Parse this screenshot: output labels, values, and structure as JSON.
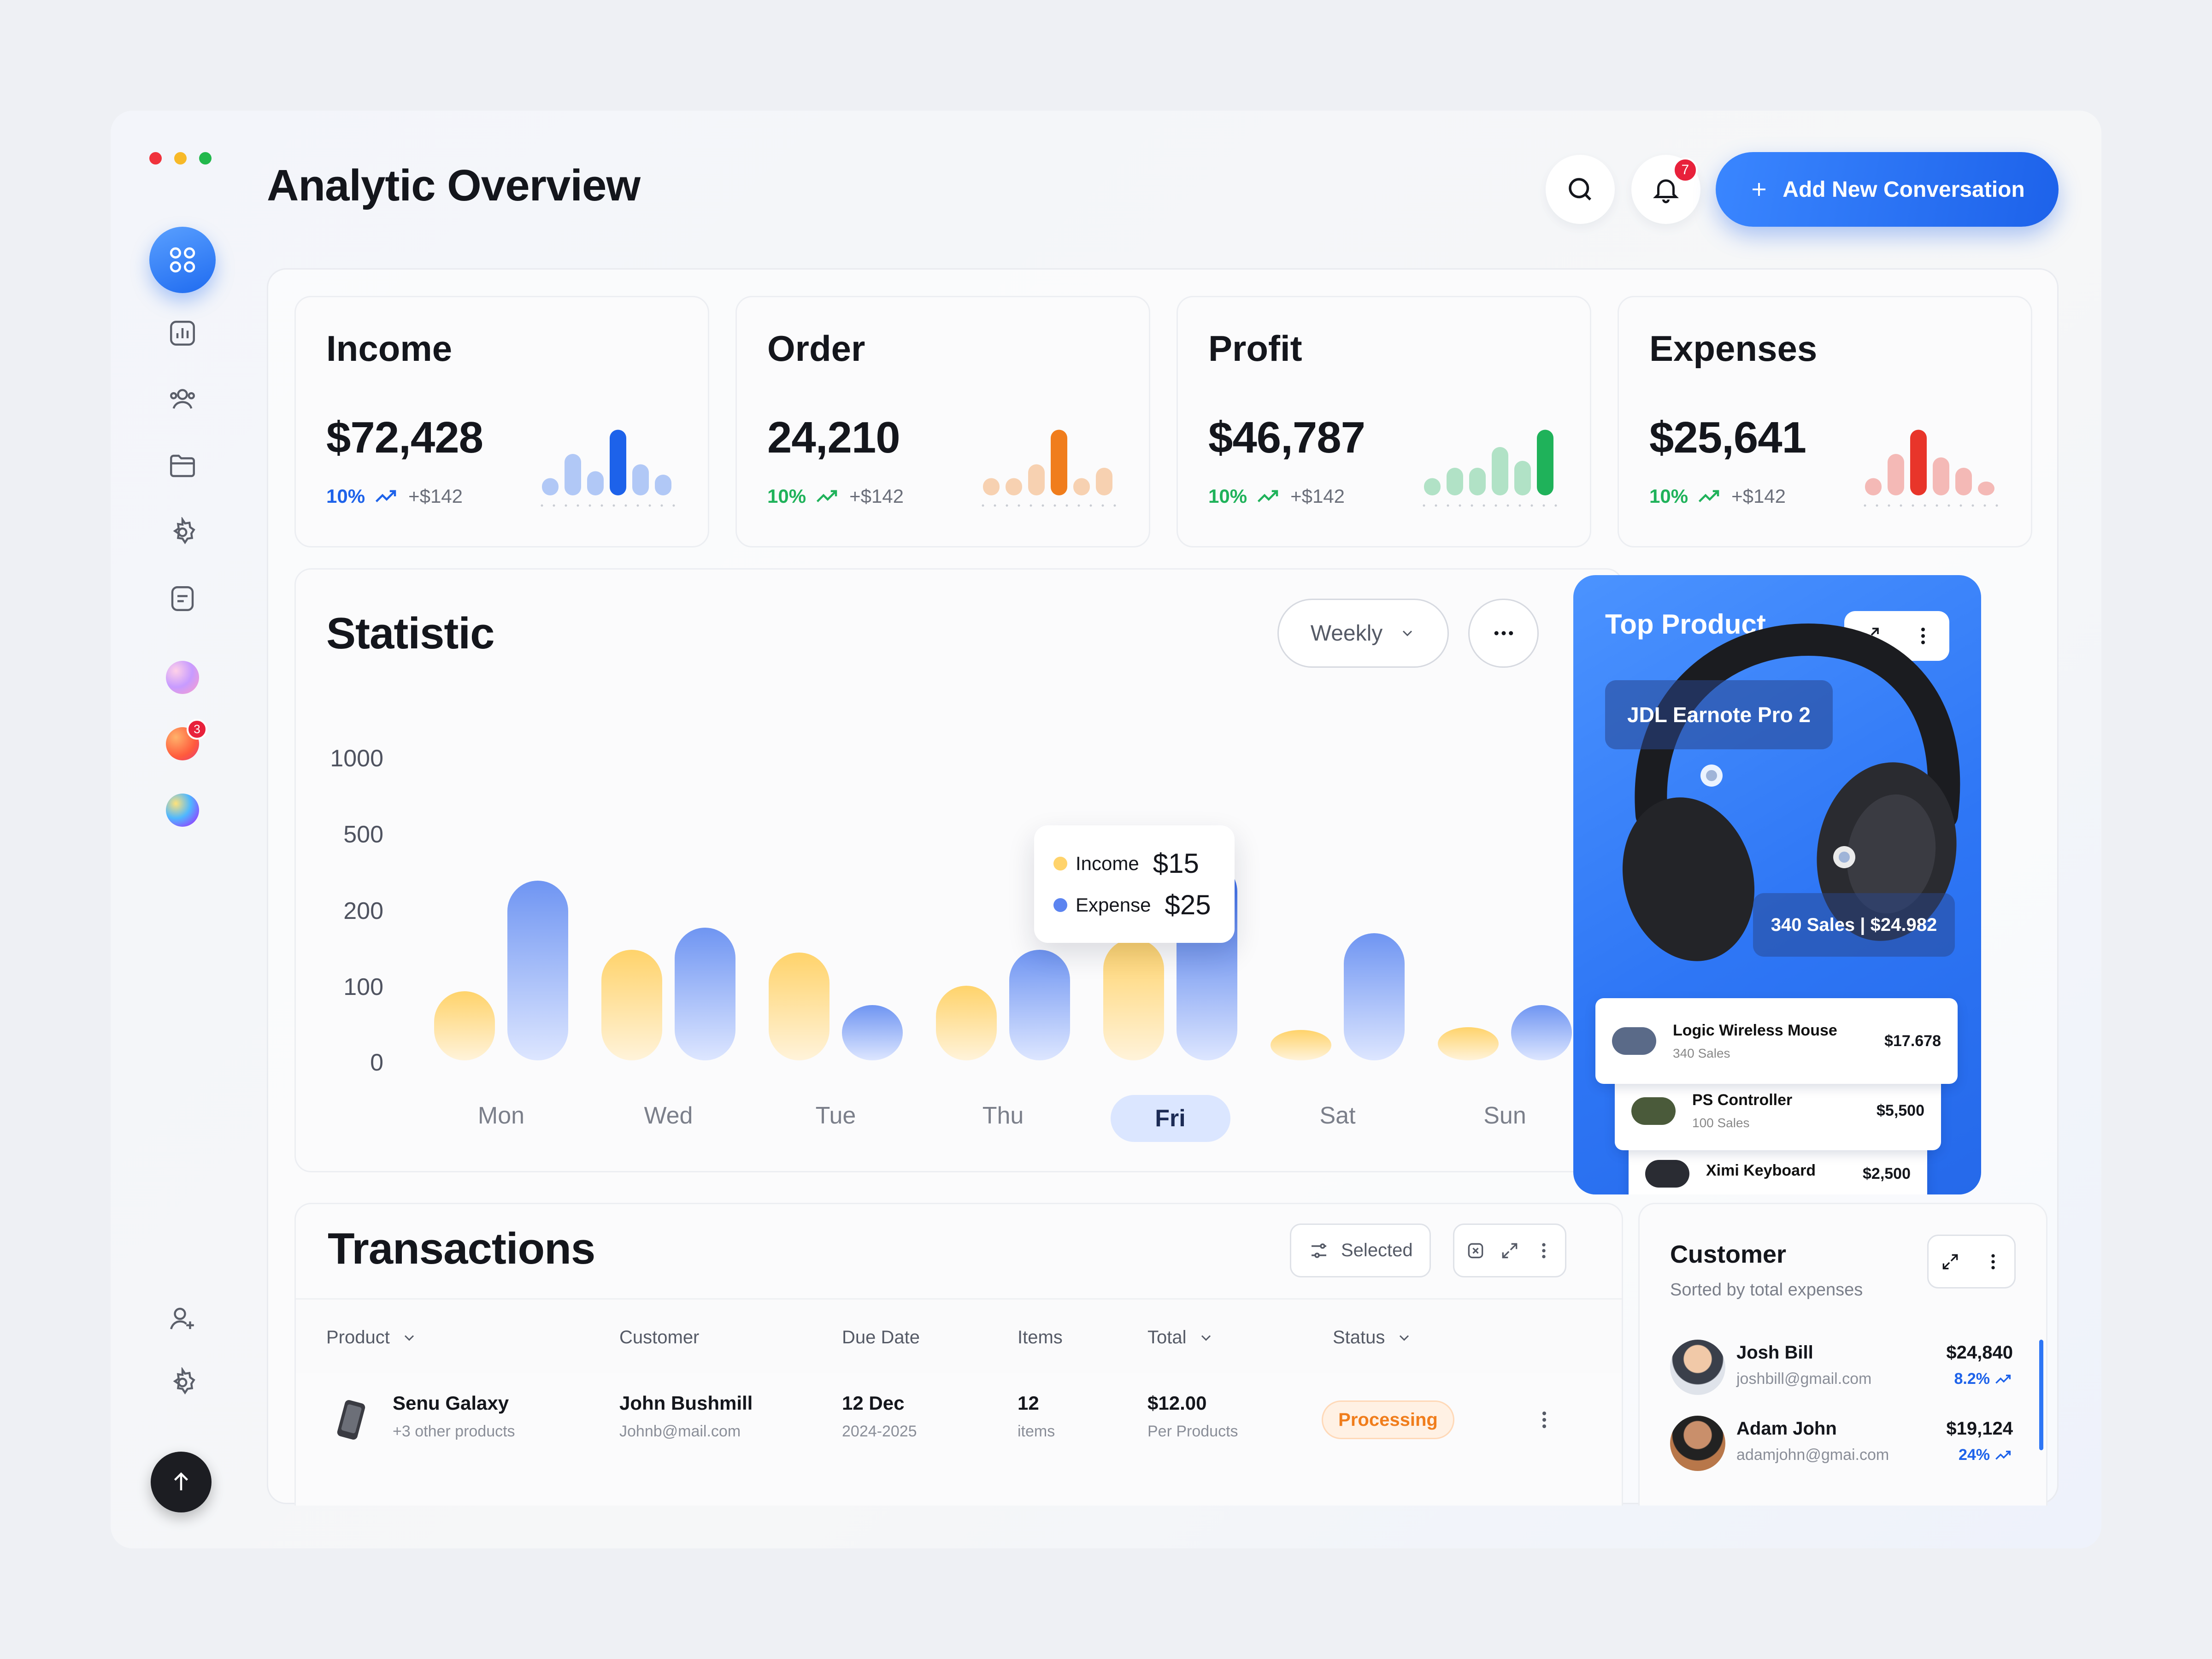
{
  "header": {
    "title": "Analytic Overview",
    "notification_count": "7",
    "cta_label": "Add New Conversation"
  },
  "sidebar": {
    "nav_icons": [
      "dashboard-icon",
      "bar-chart-icon",
      "users-icon",
      "folder-icon",
      "settings-icon",
      "document-icon"
    ],
    "workspace_badge": "3",
    "bottom_icons": [
      "add-user-icon",
      "settings-icon",
      "arrow-up-icon"
    ]
  },
  "kpis": [
    {
      "title": "Income",
      "value": "$72,428",
      "pct": "10%",
      "delta": "+$142",
      "color": "#1d62ea",
      "bars": [
        0.25,
        0.6,
        0.35,
        0.95,
        0.45,
        0.3
      ]
    },
    {
      "title": "Order",
      "value": "24,210",
      "pct": "10%",
      "delta": "+$142",
      "color": "#f07d1c",
      "bars": [
        0.25,
        0.25,
        0.45,
        0.95,
        0.25,
        0.4
      ]
    },
    {
      "title": "Profit",
      "value": "$46,787",
      "pct": "10%",
      "delta": "+$142",
      "color": "#1fb25a",
      "bars": [
        0.25,
        0.4,
        0.4,
        0.7,
        0.5,
        0.95
      ]
    },
    {
      "title": "Expenses",
      "value": "$25,641",
      "pct": "10%",
      "delta": "+$142",
      "color": "#e8352a",
      "bars": [
        0.25,
        0.6,
        0.95,
        0.55,
        0.4,
        0.2
      ]
    }
  ],
  "statistic": {
    "title": "Statistic",
    "period": "Weekly",
    "tooltip": {
      "income_label": "Income",
      "income_value": "$15",
      "expense_label": "Expense",
      "expense_value": "$25"
    },
    "active_day": "Fri"
  },
  "chart_data": {
    "type": "bar",
    "categories": [
      "Mon",
      "Wed",
      "Tue",
      "Thu",
      "Fri",
      "Sat",
      "Sun"
    ],
    "y_ticks": [
      "1000",
      "500",
      "200",
      "100",
      "0"
    ],
    "series": [
      {
        "name": "Income",
        "color": "#ffd36b",
        "values": [
          250,
          400,
          390,
          270,
          440,
          110,
          120
        ]
      },
      {
        "name": "Expense",
        "color": "#6f95f2",
        "values": [
          650,
          480,
          200,
          400,
          720,
          460,
          200
        ]
      }
    ],
    "ylim": [
      0,
      1000
    ]
  },
  "top_product": {
    "title": "Top Product",
    "product_name": "JDL Earnote Pro 2",
    "sales_summary": "340 Sales | $24.982",
    "items": [
      {
        "name": "Logic Wireless Mouse",
        "sales": "340 Sales",
        "price": "$17.678"
      },
      {
        "name": "PS Controller",
        "sales": "100 Sales",
        "price": "$5,500"
      },
      {
        "name": "Ximi Keyboard",
        "sales": "",
        "price": "$2,500"
      }
    ]
  },
  "transactions": {
    "title": "Transactions",
    "filter_label": "Selected",
    "columns": [
      "Product",
      "Customer",
      "Due Date",
      "Items",
      "Total",
      "Status"
    ],
    "rows": [
      {
        "product": "Senu Galaxy",
        "product_sub": "+3 other products",
        "customer": "John Bushmill",
        "customer_sub": "Johnb@mail.com",
        "date": "12 Dec",
        "date_sub": "2024-2025",
        "items": "12",
        "items_sub": "items",
        "total": "$12.00",
        "total_sub": "Per Products",
        "status": "Processing"
      }
    ]
  },
  "customer": {
    "title": "Customer",
    "subtitle": "Sorted by total expenses",
    "rows": [
      {
        "name": "Josh Bill",
        "email": "joshbill@gmail.com",
        "amount": "$24,840",
        "pct": "8.2%"
      },
      {
        "name": "Adam John",
        "email": "adamjohn@gmai.com",
        "amount": "$19,124",
        "pct": "24%"
      }
    ]
  }
}
